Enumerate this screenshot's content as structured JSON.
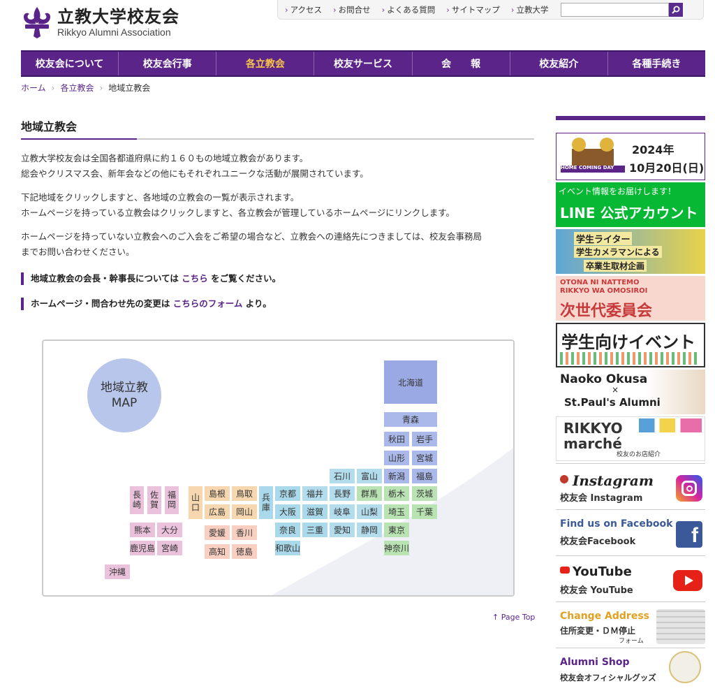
{
  "logo": {
    "jp": "立教大学校友会",
    "en": "Rikkyo Alumni Association"
  },
  "topnav": [
    "アクセス",
    "お問合せ",
    "よくある質問",
    "サイトマップ",
    "立教大学"
  ],
  "search": {
    "placeholder": ""
  },
  "gnav": [
    {
      "label": "校友会について",
      "active": false
    },
    {
      "label": "校友会行事",
      "active": false
    },
    {
      "label": "各立教会",
      "active": true
    },
    {
      "label": "校友サービス",
      "active": false
    },
    {
      "label": "会　　報",
      "active": false
    },
    {
      "label": "校友紹介",
      "active": false
    },
    {
      "label": "各種手続き",
      "active": false
    }
  ],
  "breadcrumb": {
    "home": "ホーム",
    "parent": "各立教会",
    "current": "地域立教会"
  },
  "page": {
    "title": "地域立教会",
    "p1a": "立教大学校友会は全国各都道府県に約１６０もの地域立教会があります。",
    "p1b": "総会やクリスマス会、新年会などの他にもそれぞれユニークな活動が展開されています。",
    "p2a": "下記地域をクリックしますと、各地域の立教会の一覧が表示されます。",
    "p2b": "ホームページを持っている立教会はクリックしますと、各立教会が管理しているホームページにリンクします。",
    "p3a": "ホームページを持っていない立教会へのご入会をご希望の場合など、立教会への連絡先につきましては、校友会事務局",
    "p3b": "までお問い合わせください。",
    "note1_pre": "地域立教会の会長・幹事長については",
    "note1_link": "こちら",
    "note1_post": "をご覧ください。",
    "note2_pre": "ホームページ・問合わせ先の変更は",
    "note2_link": "こちらのフォーム",
    "note2_post": "より。",
    "pagetop": "↑ Page Top"
  },
  "map": {
    "title": "地域立教\nMAP",
    "colors": {
      "hokkaido": "#9aa9e3",
      "tohoku": "#aab8ea",
      "kanto": "#b9e3b3",
      "chubu": "#b3dced",
      "kinki": "#a9d9ea",
      "chugoku": "#f6d7b0",
      "shikoku": "#f8cfc0",
      "kyushu": "#ebc2dc"
    }
  },
  "sidebar": {
    "hcd": {
      "year": "2024年",
      "date": "10月20日(日)",
      "label": "HOME COMING DAY"
    },
    "line": {
      "top": "イベント情報をお届けします！",
      "main": "LINE 公式アカウント"
    },
    "writer": {
      "l1": "学生ライター",
      "l2": "学生カメラマンによる",
      "l3": "卒業生取材企画"
    },
    "next": {
      "en1": "OTONA NI NATTEMO",
      "en2": "RIKKYO WA OMOSIROI",
      "jp": "次世代委員会"
    },
    "student": {
      "main": "学生向けイベント"
    },
    "naoko": {
      "l1": "Naoko Okusa",
      "x": "×",
      "l2": "St.Paul's Alumni"
    },
    "marche": {
      "l1": "RIKKYO",
      "l2": "marché",
      "l3": "校友のお店紹介"
    },
    "insta": {
      "l1": "Instagram",
      "l2": "校友会 Instagram"
    },
    "fb": {
      "l1": "Find us on Facebook",
      "l2": "校友会Facebook"
    },
    "yt": {
      "l1": "YouTube",
      "l2": "校友会 YouTube"
    },
    "addr": {
      "l1": "Change Address",
      "l2": "住所変更・ＤＭ停止",
      "l3": "フォーム"
    },
    "shop": {
      "l1": "Alumni Shop",
      "l2": "校友会オフィシャルグッズ"
    }
  },
  "prefs": [
    {
      "n": "北海道",
      "r": "hokkaido"
    },
    {
      "n": "青森",
      "r": "tohoku"
    },
    {
      "n": "秋田",
      "r": "tohoku"
    },
    {
      "n": "岩手",
      "r": "tohoku"
    },
    {
      "n": "山形",
      "r": "tohoku"
    },
    {
      "n": "宮城",
      "r": "tohoku"
    },
    {
      "n": "新潟",
      "r": "tohoku"
    },
    {
      "n": "福島",
      "r": "tohoku"
    },
    {
      "n": "石川",
      "r": "chubu"
    },
    {
      "n": "富山",
      "r": "chubu"
    },
    {
      "n": "福井",
      "r": "chubu"
    },
    {
      "n": "長野",
      "r": "chubu"
    },
    {
      "n": "群馬",
      "r": "kanto"
    },
    {
      "n": "栃木",
      "r": "kanto"
    },
    {
      "n": "茨城",
      "r": "kanto"
    },
    {
      "n": "京都",
      "r": "kinki"
    },
    {
      "n": "大阪",
      "r": "kinki"
    },
    {
      "n": "滋賀",
      "r": "kinki"
    },
    {
      "n": "岐阜",
      "r": "chubu"
    },
    {
      "n": "山梨",
      "r": "chubu"
    },
    {
      "n": "埼玉",
      "r": "kanto"
    },
    {
      "n": "千葉",
      "r": "kanto"
    },
    {
      "n": "奈良",
      "r": "kinki"
    },
    {
      "n": "三重",
      "r": "kinki"
    },
    {
      "n": "愛知",
      "r": "chubu"
    },
    {
      "n": "静岡",
      "r": "chubu"
    },
    {
      "n": "東京",
      "r": "kanto"
    },
    {
      "n": "和歌山",
      "r": "kinki"
    },
    {
      "n": "神奈川",
      "r": "kanto"
    },
    {
      "n": "兵庫",
      "r": "kinki"
    },
    {
      "n": "山口",
      "r": "chugoku"
    },
    {
      "n": "島根",
      "r": "chugoku"
    },
    {
      "n": "鳥取",
      "r": "chugoku"
    },
    {
      "n": "広島",
      "r": "chugoku"
    },
    {
      "n": "岡山",
      "r": "chugoku"
    },
    {
      "n": "愛媛",
      "r": "shikoku"
    },
    {
      "n": "香川",
      "r": "shikoku"
    },
    {
      "n": "高知",
      "r": "shikoku"
    },
    {
      "n": "徳島",
      "r": "shikoku"
    },
    {
      "n": "長崎",
      "r": "kyushu"
    },
    {
      "n": "佐賀",
      "r": "kyushu"
    },
    {
      "n": "福岡",
      "r": "kyushu"
    },
    {
      "n": "熊本",
      "r": "kyushu"
    },
    {
      "n": "大分",
      "r": "kyushu"
    },
    {
      "n": "鹿児島",
      "r": "kyushu"
    },
    {
      "n": "宮崎",
      "r": "kyushu"
    },
    {
      "n": "沖縄",
      "r": "kyushu"
    }
  ]
}
